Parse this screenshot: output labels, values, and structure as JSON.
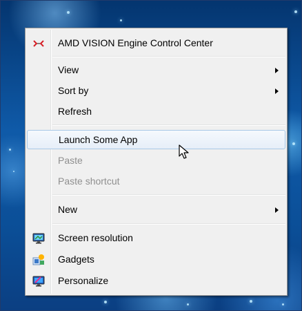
{
  "desktop": {
    "wallpaper": "blue-sparkle-desktop-background"
  },
  "context_menu": {
    "items": [
      {
        "label": "AMD VISION Engine Control Center",
        "icon": "amd-icon"
      },
      {
        "label": "View",
        "has_submenu": true
      },
      {
        "label": "Sort by",
        "has_submenu": true
      },
      {
        "label": "Refresh"
      },
      {
        "label": "Launch Some App",
        "highlighted": true
      },
      {
        "label": "Paste",
        "enabled": false
      },
      {
        "label": "Paste shortcut",
        "enabled": false
      },
      {
        "label": "New",
        "has_submenu": true
      },
      {
        "label": "Screen resolution",
        "icon": "monitor-icon"
      },
      {
        "label": "Gadgets",
        "icon": "gadgets-icon"
      },
      {
        "label": "Personalize",
        "icon": "personalize-icon"
      }
    ]
  },
  "colors": {
    "menu_background": "#f0f0f0",
    "highlight_border": "#a8c8e6",
    "disabled_text": "#8f8f8f",
    "amd_red": "#d51f26"
  },
  "pointer": "arrow-cursor-icon"
}
